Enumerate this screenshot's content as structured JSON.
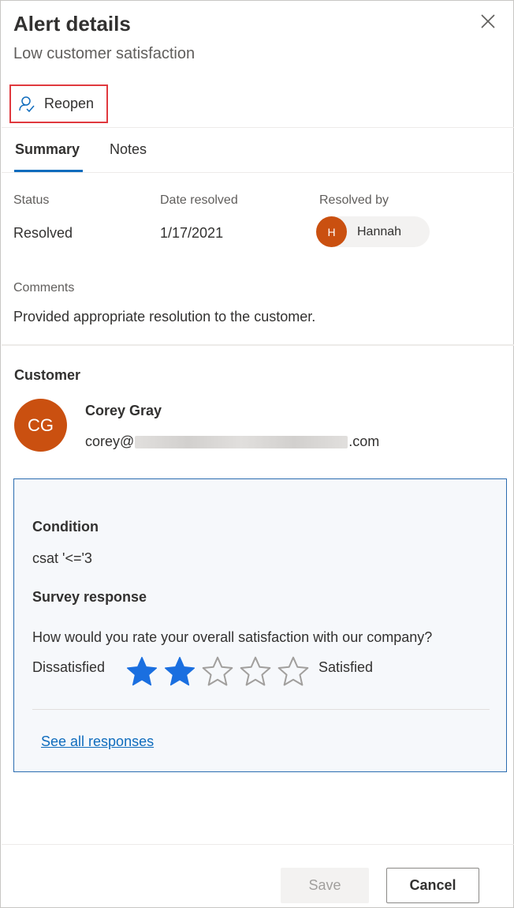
{
  "header": {
    "title": "Alert details",
    "subtitle": "Low customer satisfaction",
    "close_icon": "close-icon"
  },
  "toolbar": {
    "reopen_label": "Reopen",
    "reopen_icon": "person-check-icon",
    "highlight_color": "#e0393e"
  },
  "tabs": [
    {
      "label": "Summary",
      "selected": true
    },
    {
      "label": "Notes",
      "selected": false
    }
  ],
  "summary": {
    "status_label": "Status",
    "status_value": "Resolved",
    "date_label": "Date resolved",
    "date_value": "1/17/2021",
    "resolved_by_label": "Resolved by",
    "resolved_by_initial": "H",
    "resolved_by_name": "Hannah",
    "comments_label": "Comments",
    "comments_value": "Provided appropriate resolution to the customer."
  },
  "customer": {
    "section_title": "Customer",
    "initials": "CG",
    "name": "Corey Gray",
    "email_prefix": "corey@",
    "email_suffix": ".com",
    "avatar_color": "#ca5010"
  },
  "condition": {
    "title": "Condition",
    "value": "csat '<='3",
    "survey_title": "Survey response",
    "question": "How would you rate your overall satisfaction with our company?",
    "low_label": "Dissatisfied",
    "high_label": "Satisfied",
    "rating": 2,
    "max_rating": 5,
    "see_all_label": "See all responses"
  },
  "footer": {
    "save_label": "Save",
    "cancel_label": "Cancel"
  },
  "colors": {
    "accent": "#0f6cbd",
    "star_filled": "#1a6fe0",
    "star_empty": "#a19f9d"
  }
}
